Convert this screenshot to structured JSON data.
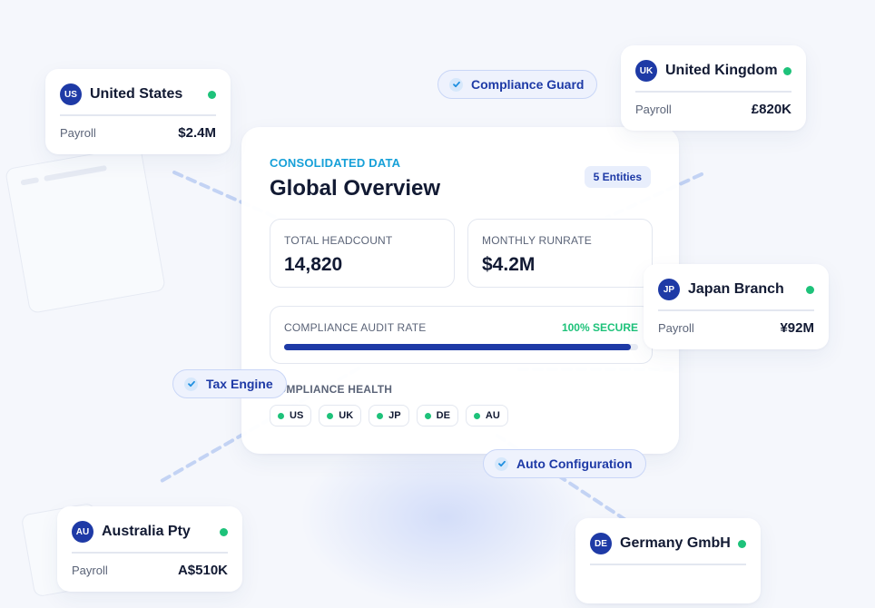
{
  "entities": {
    "us": {
      "code": "US",
      "name": "United States",
      "label": "Payroll",
      "value": "$2.4M"
    },
    "uk": {
      "code": "UK",
      "name": "United Kingdom",
      "label": "Payroll",
      "value": "£820K"
    },
    "jp": {
      "code": "JP",
      "name": "Japan Branch",
      "label": "Payroll",
      "value": "¥92M"
    },
    "au": {
      "code": "AU",
      "name": "Australia Pty",
      "label": "Payroll",
      "value": "A$510K"
    },
    "de": {
      "code": "DE",
      "name": "Germany GmbH"
    }
  },
  "overview": {
    "eyebrow": "CONSOLIDATED DATA",
    "title": "Global Overview",
    "entities_pill": "5 Entities",
    "headcount_label": "TOTAL HEADCOUNT",
    "headcount_value": "14,820",
    "runrate_label": "MONTHLY RUNRATE",
    "runrate_value": "$4.2M",
    "audit_label": "COMPLIANCE AUDIT RATE",
    "audit_status": "100% SECURE",
    "audit_progress": 0.98,
    "health_label": "COMPLIANCE HEALTH",
    "health_chips": [
      "US",
      "UK",
      "JP",
      "DE",
      "AU"
    ]
  },
  "tags": {
    "compliance_guard": "Compliance Guard",
    "tax_engine": "Tax Engine",
    "auto_configuration": "Auto Configuration"
  },
  "colors": {
    "accent": "#1e3aa6",
    "eyebrow": "#16a0d8",
    "status_ok": "#1ec27a",
    "background": "#f5f7fc"
  },
  "icons": {
    "status_dot": "green-status-dot-icon",
    "check": "check-badge-icon"
  }
}
